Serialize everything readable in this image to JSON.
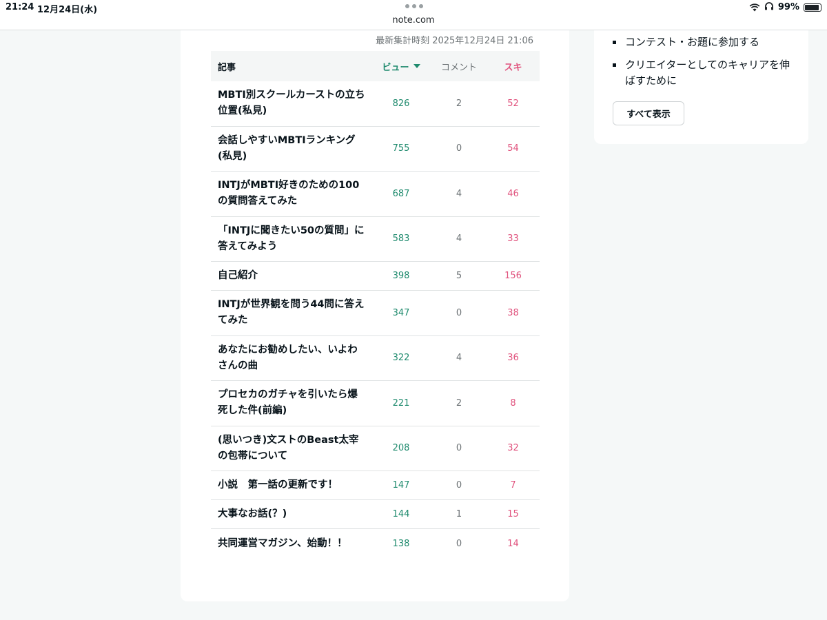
{
  "statusbar": {
    "time": "21:24",
    "date": "12月24日(水)",
    "url": "note.com",
    "battery": "99%"
  },
  "stats": {
    "updated": "最新集計時刻 2025年12月24日 21:06",
    "headers": {
      "title": "記事",
      "views": "ビュー",
      "comments": "コメント",
      "likes": "スキ"
    },
    "rows": [
      {
        "title": "MBTI別スクールカーストの立ち位置(私見)",
        "views": "826",
        "comments": "2",
        "likes": "52"
      },
      {
        "title": "会話しやすいMBTIランキング(私見)",
        "views": "755",
        "comments": "0",
        "likes": "54"
      },
      {
        "title": "INTJがMBTI好きのための100の質問答えてみた",
        "views": "687",
        "comments": "4",
        "likes": "46"
      },
      {
        "title": "「INTJに聞きたい50の質問」に答えてみよう",
        "views": "583",
        "comments": "4",
        "likes": "33"
      },
      {
        "title": "自己紹介",
        "views": "398",
        "comments": "5",
        "likes": "156"
      },
      {
        "title": "INTJが世界観を問う44問に答えてみた",
        "views": "347",
        "comments": "0",
        "likes": "38"
      },
      {
        "title": "あなたにお勧めしたい、いよわさんの曲",
        "views": "322",
        "comments": "4",
        "likes": "36"
      },
      {
        "title": "プロセカのガチャを引いたら爆死した件(前編)",
        "views": "221",
        "comments": "2",
        "likes": "8"
      },
      {
        "title": "(思いつき)文ストのBeast太宰の包帯について",
        "views": "208",
        "comments": "0",
        "likes": "32"
      },
      {
        "title": "小説　第一話の更新です！",
        "views": "147",
        "comments": "0",
        "likes": "7"
      },
      {
        "title": "大事なお話(？)",
        "views": "144",
        "comments": "1",
        "likes": "15"
      },
      {
        "title": "共同運営マガジン、始動！！",
        "views": "138",
        "comments": "0",
        "likes": "14"
      }
    ]
  },
  "sidebar": {
    "items": [
      "コンテスト・お題に参加する",
      "クリエイターとしてのキャリアを伸ばすために"
    ],
    "show_all": "すべて表示"
  },
  "colors": {
    "views": "#1e8a6d",
    "likes": "#e0527d"
  }
}
